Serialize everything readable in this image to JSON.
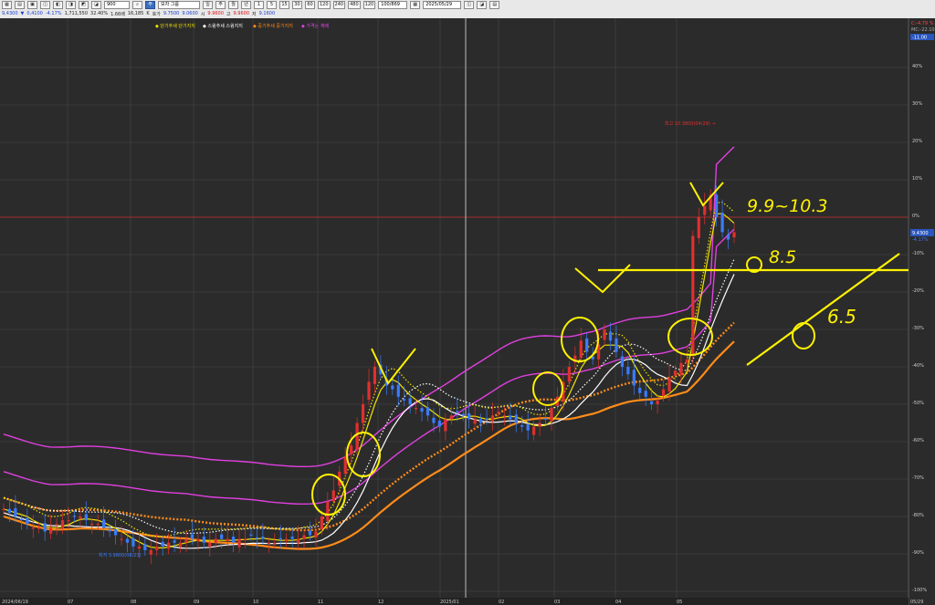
{
  "toolbar": {
    "row1": [
      "▦",
      "▤",
      "▣",
      "◫",
      "◧",
      "◨",
      "◩",
      "◪",
      "◐"
    ],
    "symbol_code": "900",
    "stock_name": "모차 그룹",
    "dwmy": [
      "일",
      "주",
      "월",
      "년"
    ],
    "timeframes": [
      "1",
      "5",
      "15",
      "30",
      "60",
      "120",
      "240",
      "480",
      "120"
    ],
    "count": "100/869",
    "date": "2025/05/29",
    "right_btns": [
      "◫",
      "◪",
      "▤"
    ],
    "quote": {
      "price": "9,4300",
      "change_mark": "▼",
      "change": "0,4100",
      "rate": "-4.17%",
      "volume": "1,711,550",
      "vol_rate": "32.40%",
      "v2": "1.66배",
      "v3": "16,185",
      "label_k": "K",
      "prev_label": "호가",
      "prev": "9.7500",
      "open_label": "",
      "open": "9.0600",
      "high_label": "시",
      "high": "9.9600",
      "low_label": "고",
      "low": "9.9600",
      "close_label": "저",
      "close": "9.1600"
    }
  },
  "legend": {
    "items": [
      {
        "text": "◆ 단기추세 단기지지",
        "color": "#f2e300"
      },
      {
        "text": "◆ 스윙추세 스윙지지",
        "color": "#ffffff"
      },
      {
        "text": "◆ 중기추세 중기지지",
        "color": "#ff8c1a"
      },
      {
        "text": "◆ 가격는 재배",
        "color": "#e040e0"
      }
    ]
  },
  "axis": {
    "y_ticks": [
      "40%",
      "30%",
      "20%",
      "10%",
      "0%",
      "-10%",
      "-20%",
      "-30%",
      "-40%",
      "-50%",
      "-60%",
      "-70%",
      "-80%",
      "-90%",
      "-100%"
    ],
    "x_ticks": [
      "2024/06/19",
      "07",
      "08",
      "09",
      "10",
      "11",
      "12",
      "2025/01",
      "02",
      "03",
      "04",
      "05",
      "05/29"
    ],
    "top_right_a": "C:-4.79 %",
    "top_right_b": "MC:-22.10",
    "top_right_c": "-11.00",
    "price_tag": "9.4300",
    "price_tag_pct": "-4.17%"
  },
  "annotations": {
    "high_label": "최고 10.3800(04/29) →",
    "low_label": "최저 3.9800(08/23)",
    "hw1": "9.9~10.3",
    "hw2": "8.5",
    "hw3": "6.5"
  },
  "colors": {
    "bg": "#2b2b2b",
    "grid": "#474747",
    "up": "#e0302f",
    "down": "#3a7cff",
    "short": "#f2e300",
    "swing": "#ffffff",
    "mid": "#ff8c1a",
    "band": "#e040e0",
    "zero": "#c72a2a",
    "annot": "#fff200"
  },
  "chart_data": {
    "type": "candlestick",
    "title": "",
    "period": {
      "start": "2024/06/19",
      "end": "2025/05/29"
    },
    "y_axis": {
      "unit": "%",
      "ylim": [
        -100,
        45
      ]
    },
    "zero_line_pct": 0,
    "closes": [
      -78,
      -79,
      -80,
      -81,
      -82,
      -83,
      -83,
      -84,
      -83,
      -82,
      -81,
      -81,
      -80,
      -80,
      -81,
      -82,
      -82,
      -83,
      -84,
      -85,
      -86,
      -87,
      -88,
      -88,
      -89,
      -89,
      -88,
      -88,
      -87,
      -87,
      -87,
      -86,
      -86,
      -86,
      -87,
      -87,
      -86,
      -86,
      -86,
      -87,
      -86,
      -86,
      -85,
      -86,
      -86,
      -87,
      -87,
      -86,
      -86,
      -86,
      -86,
      -85,
      -85,
      -84,
      -80,
      -76,
      -73,
      -68,
      -64,
      -61,
      -55,
      -50,
      -44,
      -40,
      -42,
      -45,
      -46,
      -48,
      -49,
      -50,
      -51,
      -52,
      -53,
      -55,
      -56,
      -54,
      -53,
      -52,
      -53,
      -54,
      -54,
      -55,
      -54,
      -53,
      -52,
      -53,
      -54,
      -55,
      -56,
      -57,
      -56,
      -55,
      -54,
      -51,
      -48,
      -44,
      -40,
      -37,
      -33,
      -36,
      -38,
      -34,
      -30,
      -33,
      -36,
      -40,
      -42,
      -45,
      -47,
      -48,
      -50,
      -49,
      -46,
      -43,
      -41,
      -39,
      -38,
      -5,
      0,
      3,
      6,
      0,
      -4,
      -6,
      -4
    ],
    "series": [
      {
        "name": "단기추세 단기지지",
        "color": "#f2e300"
      },
      {
        "name": "스윙추세 스윙지지",
        "color": "#ffffff"
      },
      {
        "name": "중기추세 중기지지",
        "color": "#ff8c1a"
      },
      {
        "name": "가격는 재배",
        "color": "#e040e0"
      }
    ],
    "grid": true,
    "legend_position": "top-center"
  }
}
